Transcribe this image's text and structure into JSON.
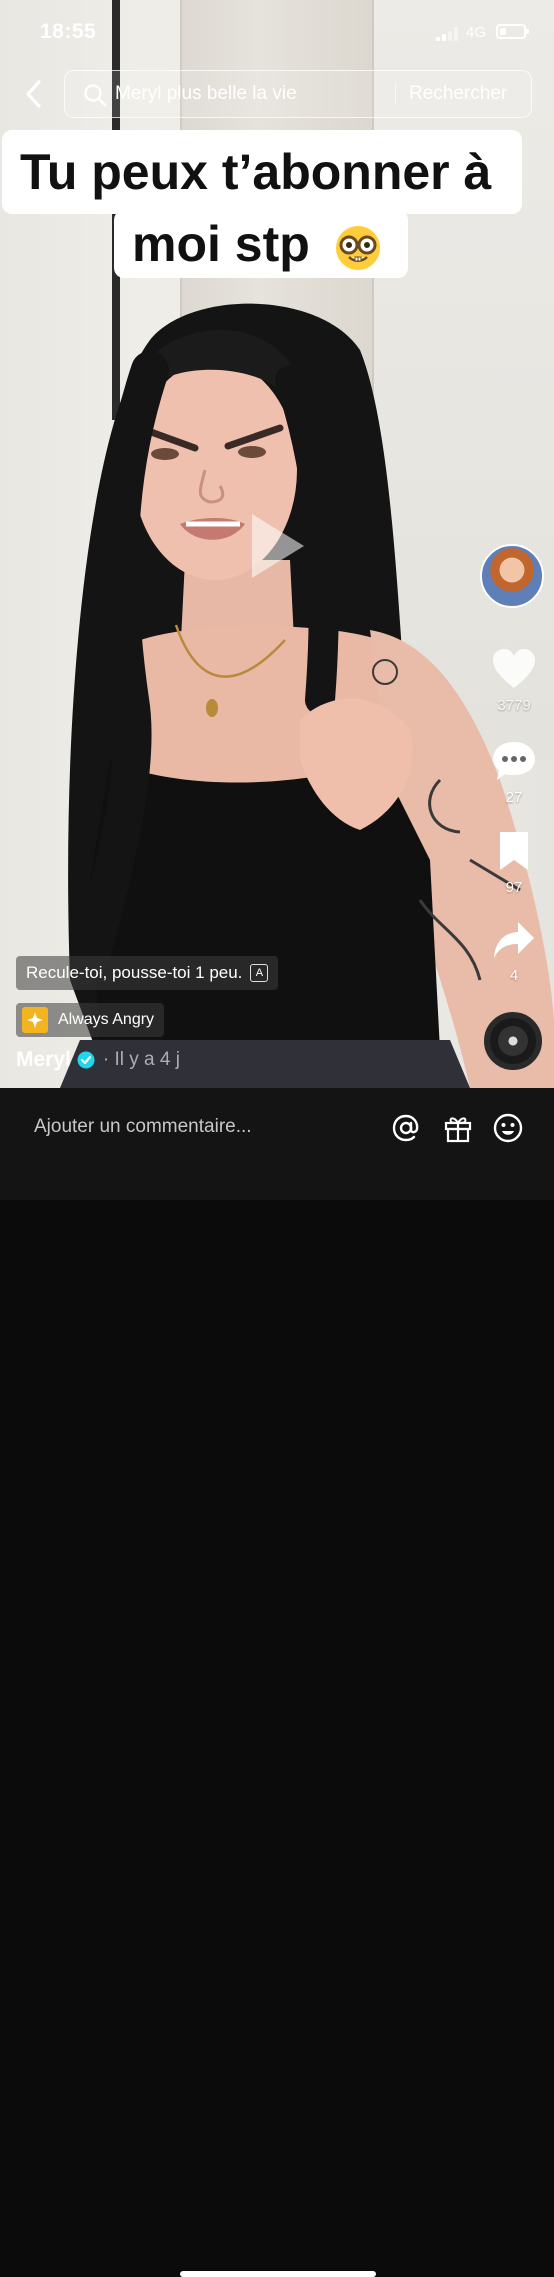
{
  "status_bar": {
    "time": "18:55",
    "network": "4G",
    "signal_bars_active": 2,
    "battery_level_fraction": 0.25
  },
  "header": {
    "back_icon": "chevron-left-icon",
    "search_icon": "search-icon",
    "search_query": "Meryl plus belle la vie",
    "search_button": "Rechercher"
  },
  "caption": {
    "line_1": "Tu peux t’abonner à",
    "line_2": "moi stp",
    "emoji": "nerd-face-emoji"
  },
  "actions": {
    "like_count": "3779",
    "comment_count": "27",
    "save_count": "97",
    "share_count": "4"
  },
  "video_info": {
    "subtitle": "Recule-toi, pousse-toi 1 peu.",
    "translate_icon": "A",
    "effect_name": "Always Angry",
    "username": "Meryl",
    "posted": "· Il y a 4 j"
  },
  "comment_bar": {
    "placeholder": "Ajouter un commentaire..."
  },
  "colors": {
    "accent_verified": "#20d5ec",
    "effect_badge": "#f3b420",
    "comment_bar_bg": "#141414"
  }
}
